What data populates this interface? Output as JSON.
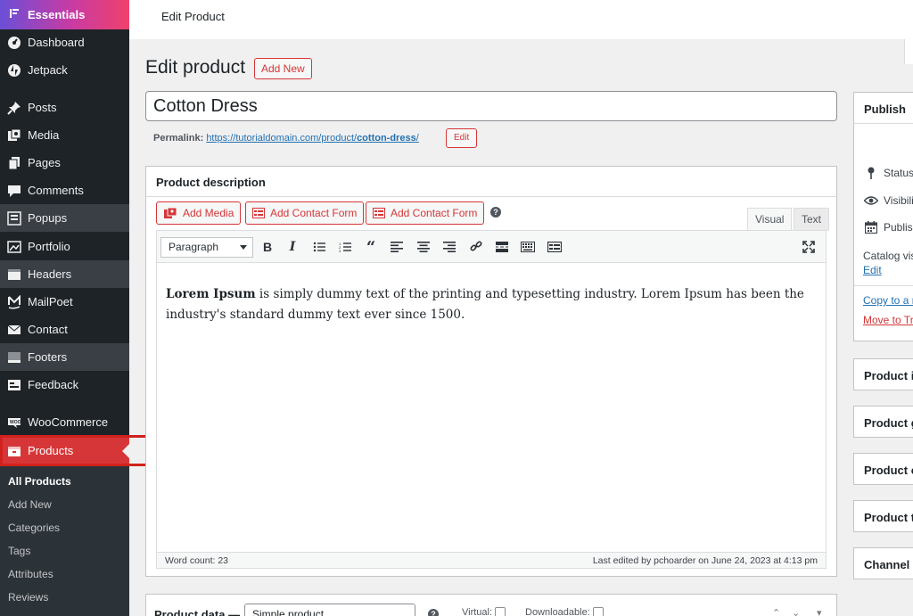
{
  "sidebar": {
    "essentials": "Essentials",
    "items": [
      {
        "label": "Dashboard",
        "icon": "dashboard-icon"
      },
      {
        "label": "Jetpack",
        "icon": "jetpack-icon"
      },
      {
        "label": "Posts",
        "icon": "pin-icon"
      },
      {
        "label": "Media",
        "icon": "media-icon"
      },
      {
        "label": "Pages",
        "icon": "pages-icon"
      },
      {
        "label": "Comments",
        "icon": "comments-icon"
      },
      {
        "label": "Popups",
        "icon": "popups-icon"
      },
      {
        "label": "Portfolio",
        "icon": "portfolio-icon"
      },
      {
        "label": "Headers",
        "icon": "headers-icon"
      },
      {
        "label": "MailPoet",
        "icon": "mailpoet-icon"
      },
      {
        "label": "Contact",
        "icon": "mail-icon"
      },
      {
        "label": "Footers",
        "icon": "footers-icon"
      },
      {
        "label": "Feedback",
        "icon": "feedback-icon"
      },
      {
        "label": "WooCommerce",
        "icon": "woocommerce-icon"
      },
      {
        "label": "Products",
        "icon": "products-icon"
      }
    ],
    "submenu": [
      "All Products",
      "Add New",
      "Categories",
      "Tags",
      "Attributes",
      "Reviews"
    ]
  },
  "topbar": {
    "title": "Edit Product"
  },
  "page": {
    "heading": "Edit product",
    "add_new": "Add New"
  },
  "post": {
    "title": "Cotton Dress",
    "permalink_label": "Permalink:",
    "permalink_base": "https://tutorialdomain.com/product/",
    "permalink_slug": "cotton-dress",
    "permalink_end": "/",
    "edit_label": "Edit"
  },
  "description": {
    "heading": "Product description",
    "add_media": "Add Media",
    "contact_form_1": "Add Contact Form",
    "contact_form_2": "Add Contact Form",
    "help": "?",
    "tab_visual": "Visual",
    "tab_text": "Text",
    "format": "Paragraph",
    "content_bold": "Lorem Ipsum",
    "content_rest": " is simply dummy text of the printing and typesetting industry. Lorem Ipsum has been the industry's standard dummy text ever since 1500.",
    "word_count": "Word count: 23",
    "last_edited": "Last edited by pchoarder on June 24, 2023 at 4:13 pm"
  },
  "product_data": {
    "label": "Product data —",
    "type": "Simple product",
    "virtual": "Virtual:",
    "downloadable": "Downloadable:"
  },
  "publish": {
    "heading": "Publish",
    "status": "Status:",
    "visibility": "Visibili",
    "published": "Publish",
    "catalog": "Catalog vis",
    "edit": "Edit",
    "copy": "Copy to a n",
    "trash": "Move to Tr"
  },
  "panels": [
    "Product in",
    "Product g",
    "Product c",
    "Product t",
    "Channel v"
  ],
  "colors": {
    "accent": "#d63638",
    "sidebar": "#1d2327",
    "link": "#2271b1"
  }
}
